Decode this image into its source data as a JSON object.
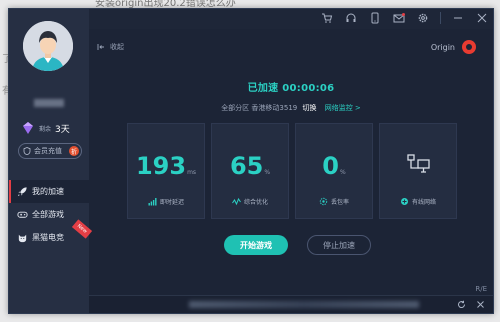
{
  "background": {
    "document_title": "安装origin出现20.2错误怎么办",
    "letters": [
      "了",
      "有"
    ]
  },
  "topbar": {
    "icons": [
      "cart-icon",
      "headset-icon",
      "phone-icon",
      "mail-icon",
      "gear-icon",
      "minimize-icon",
      "close-icon"
    ]
  },
  "sidebar": {
    "vip_small": "剩余",
    "vip_days": "3天",
    "recharge_label": "会员充值",
    "recharge_badge": "折",
    "nav": [
      {
        "label": "我的加速",
        "icon": "rocket-icon",
        "active": true
      },
      {
        "label": "全部游戏",
        "icon": "gamepad-icon",
        "active": false
      },
      {
        "label": "黑猫电竞",
        "icon": "cat-icon",
        "active": false,
        "badge": "New"
      }
    ]
  },
  "main": {
    "collapse_label": "收起",
    "game_name": "Origin",
    "status": "已加速 00:00:06",
    "region_label": "全部分区 香港移动3519",
    "region_switch": "切换",
    "region_monitor": "网络监控 >",
    "cards": [
      {
        "value": "193",
        "unit": "ms",
        "caption": "即时延迟",
        "icon": "signal-icon"
      },
      {
        "value": "65",
        "unit": "%",
        "caption": "综合优化",
        "icon": "wave-icon"
      },
      {
        "value": "0",
        "unit": "%",
        "caption": "丢包率",
        "icon": "packet-icon"
      },
      {
        "value": "",
        "unit": "",
        "caption": "有线网络",
        "icon": "network-icon"
      }
    ],
    "start_button": "开始游戏",
    "stop_button": "停止加速",
    "corner_text": "R/E"
  },
  "colors": {
    "accent": "#1fc1b3",
    "accent_text": "#2bd1c4",
    "window_bg": "#1c2436",
    "sidebar_bg": "#262f43",
    "alert_red": "#e33e45"
  }
}
